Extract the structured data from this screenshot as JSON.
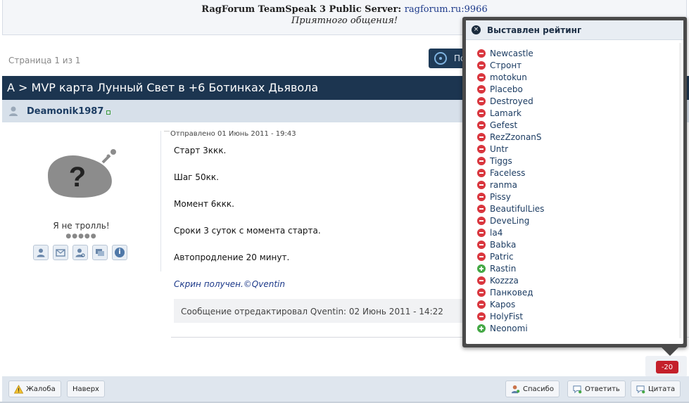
{
  "announcement": {
    "label": "RagForum TeamSpeak 3 Public Server:",
    "server": "ragforum.ru:9966",
    "greeting": "Приятного общения!"
  },
  "pagination": {
    "text": "Страница 1 из 1"
  },
  "subscribe_button": {
    "label": "По"
  },
  "topic": {
    "title": "А > MVP карта Лунный Свет в +6 Ботинках Дьявола"
  },
  "post": {
    "author": "Deamonik1987",
    "user_title": "Я не тролль!",
    "rank_pips": "●●●●●",
    "date": "Отправлено 01 Июнь 2011 - 19:43",
    "lines": [
      "Старт 3ккк.",
      "Шаг 50кк.",
      "Момент 6ккк.",
      "Сроки 3 суток с момента старта.",
      "Автопродление 20 минут."
    ],
    "signed_line": "Скрин получен.©Qventin",
    "edit_note": "Сообщение отредактировал Qventin: 02 Июнь 2011 - 14:22",
    "rating": "-20"
  },
  "user_actions": [
    {
      "icon": "view-profile-icon"
    },
    {
      "icon": "send-message-icon"
    },
    {
      "icon": "find-posts-icon"
    },
    {
      "icon": "find-topics-icon"
    },
    {
      "icon": "info-icon",
      "glyph": "i"
    }
  ],
  "controls": {
    "report": "Жалоба",
    "top": "Наверх",
    "thanks": "Спасибо",
    "reply": "Ответить",
    "quote": "Цитата"
  },
  "rating_popup": {
    "title": "Выставлен рейтинг",
    "close_glyph": "×",
    "entries": [
      {
        "name": "Newcastle",
        "vote": "minus"
      },
      {
        "name": "Стронт",
        "vote": "minus"
      },
      {
        "name": "motokun",
        "vote": "minus"
      },
      {
        "name": "Placebo",
        "vote": "minus"
      },
      {
        "name": "Destroyed",
        "vote": "minus"
      },
      {
        "name": "Lamark",
        "vote": "minus"
      },
      {
        "name": "Gefest",
        "vote": "minus"
      },
      {
        "name": "RezZzonanS",
        "vote": "minus"
      },
      {
        "name": "Untr",
        "vote": "minus"
      },
      {
        "name": "Tiggs",
        "vote": "minus"
      },
      {
        "name": "Faceless",
        "vote": "minus"
      },
      {
        "name": "ranma",
        "vote": "minus"
      },
      {
        "name": "Pissy",
        "vote": "minus"
      },
      {
        "name": "BeautifulLies",
        "vote": "minus"
      },
      {
        "name": "DeveLing",
        "vote": "minus"
      },
      {
        "name": "la4",
        "vote": "minus"
      },
      {
        "name": "Babka",
        "vote": "minus"
      },
      {
        "name": "Patric",
        "vote": "minus"
      },
      {
        "name": "Rastin",
        "vote": "plus"
      },
      {
        "name": "Kozzza",
        "vote": "minus"
      },
      {
        "name": "Панковед",
        "vote": "minus"
      },
      {
        "name": "Kapos",
        "vote": "minus"
      },
      {
        "name": "HolyFist",
        "vote": "minus"
      },
      {
        "name": "Neonomi",
        "vote": "plus"
      }
    ]
  },
  "colors": {
    "topic_bar": "#1c3550",
    "author_bar": "#d7e0ea",
    "rating_negative": "#c4202a",
    "vote_minus": "#d9363e",
    "vote_plus": "#45a845",
    "popup_frame": "#4a4a4a"
  }
}
